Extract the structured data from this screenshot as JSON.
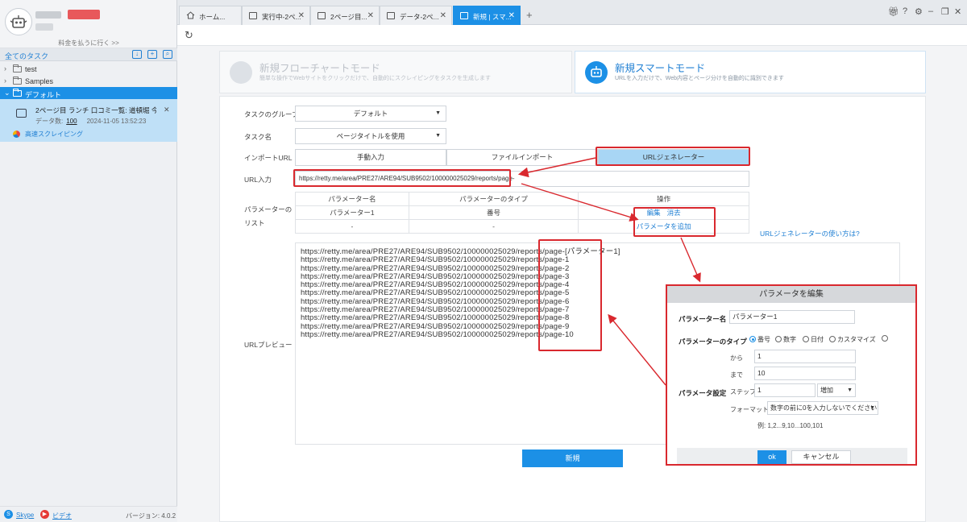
{
  "sidebar": {
    "pay_link": "料金を払うに行く >>",
    "tasks_header": "全てのタスク",
    "header_icons": [
      "download-icon",
      "add-icon",
      "search-icon"
    ],
    "folders": [
      {
        "name": "test",
        "expanded": false
      },
      {
        "name": "Samples",
        "expanded": false
      },
      {
        "name": "デフォルト",
        "expanded": true,
        "selected": true
      }
    ],
    "task": {
      "title": "2ページ目 ランチ 口コミ一覧: 道頓堀 今井...",
      "data_label": "データ数:",
      "data_count": "100",
      "timestamp": "2024-11-05 13:52:23",
      "scrape_label": "高速スクレイピング"
    },
    "footer": {
      "skype": "Skype",
      "video": "ビデオ",
      "version": "バージョン: 4.0.2"
    }
  },
  "tabs": [
    {
      "label": "ホーム...",
      "icon": "home-icon"
    },
    {
      "label": "実行中-2ペ...",
      "icon": "page-icon"
    },
    {
      "label": "2ページ目...",
      "icon": "page-icon"
    },
    {
      "label": "データ-2ペ...",
      "icon": "page-icon"
    },
    {
      "label": "新規 | スマ...",
      "icon": "page-icon",
      "active": true
    }
  ],
  "modes": {
    "flow": {
      "title": "新規フローチャートモード",
      "subtitle": "簡単な操作でWebサイトをクリックだけで、自動的にスクレイピングをタスクを生成します"
    },
    "smart": {
      "title": "新規スマートモード",
      "subtitle": "URLを入力だけで、Web内容とページ分けを自動的に識別できます"
    }
  },
  "form": {
    "group_label": "タスクのグループ",
    "group_value": "デフォルト",
    "name_label": "タスク名",
    "name_value": "ページタイトルを使用",
    "import_label": "インポートURL",
    "import_options": [
      "手動入力",
      "ファイルインポート",
      "URLジェネレーター"
    ],
    "url_label": "URL入力",
    "url_value": "https://retty.me/area/PRE27/ARE94/SUB9502/100000025029/reports/page-",
    "param_list_label": "パラメーターのリスト",
    "param_table": {
      "headers": [
        "パラメーター名",
        "パラメーターのタイプ",
        "操作"
      ],
      "row": {
        "name": "パラメーター1",
        "type": "番号",
        "edit": "編集",
        "delete": "消去"
      },
      "empty_row": [
        "-",
        "-"
      ],
      "add_param": "パラメータを追加"
    },
    "help_link": "URLジェネレーターの使い方は?",
    "preview_label": "URLプレビュー",
    "preview_urls": [
      "https://retty.me/area/PRE27/ARE94/SUB9502/100000025029/reports/page-[パラメーター1]",
      "https://retty.me/area/PRE27/ARE94/SUB9502/100000025029/reports/page-1",
      "https://retty.me/area/PRE27/ARE94/SUB9502/100000025029/reports/page-2",
      "https://retty.me/area/PRE27/ARE94/SUB9502/100000025029/reports/page-3",
      "https://retty.me/area/PRE27/ARE94/SUB9502/100000025029/reports/page-4",
      "https://retty.me/area/PRE27/ARE94/SUB9502/100000025029/reports/page-5",
      "https://retty.me/area/PRE27/ARE94/SUB9502/100000025029/reports/page-6",
      "https://retty.me/area/PRE27/ARE94/SUB9502/100000025029/reports/page-7",
      "https://retty.me/area/PRE27/ARE94/SUB9502/100000025029/reports/page-8",
      "https://retty.me/area/PRE27/ARE94/SUB9502/100000025029/reports/page-9",
      "https://retty.me/area/PRE27/ARE94/SUB9502/100000025029/reports/page-10"
    ],
    "create_button": "新規"
  },
  "dialog": {
    "title": "パラメータを編集",
    "name_label": "パラメーター名",
    "name_value": "パラメーター1",
    "type_label": "パラメーターのタイプ",
    "type_options": [
      "番号",
      "数字",
      "日付",
      "カスタマイズ"
    ],
    "type_selected": "番号",
    "settings_label": "パラメータ設定",
    "from_label": "から",
    "from_value": "1",
    "to_label": "まで",
    "to_value": "10",
    "step_label": "ステップ",
    "step_value": "1",
    "step_mode": "増加",
    "format_label": "フォーマット",
    "format_value": "数字の前に0を入力しないでください",
    "example": "例: 1,2...9,10...100,101",
    "ok": "ok",
    "cancel": "キャンセル"
  },
  "colors": {
    "accent": "#1c90e6",
    "annotation": "#d9282e",
    "selected_seg": "#a8d6f5"
  }
}
